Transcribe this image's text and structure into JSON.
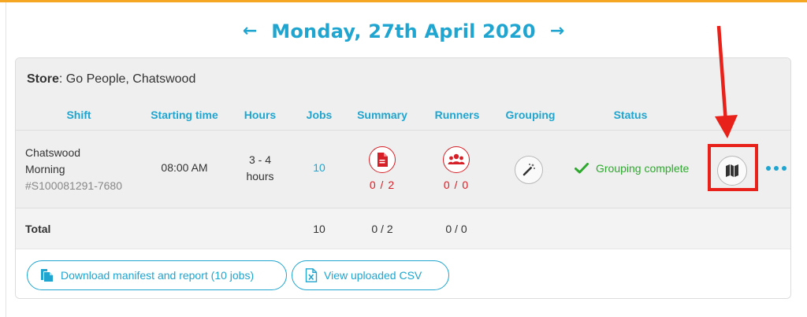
{
  "header": {
    "prev_arrow": "←",
    "next_arrow": "→",
    "date": "Monday, 27th April 2020"
  },
  "store": {
    "label": "Store",
    "value": ": Go People, Chatswood"
  },
  "table": {
    "columns": [
      "Shift",
      "Starting time",
      "Hours",
      "Jobs",
      "Summary",
      "Runners",
      "Grouping",
      "Status"
    ],
    "row": {
      "shift_line1": "Chatswood",
      "shift_line2": "Morning",
      "shift_code": "#S100081291-7680",
      "starting_time": "08:00 AM",
      "hours_line1": "3 - 4",
      "hours_line2": "hours",
      "jobs": "10",
      "summary": "0 / 2",
      "runners": "0 / 0",
      "status": "Grouping complete"
    },
    "total": {
      "label": "Total",
      "jobs": "10",
      "summary": "0 / 2",
      "runners": "0 / 0"
    }
  },
  "actions": {
    "download": "Download manifest and report (10 jobs)",
    "view_csv": "View uploaded CSV"
  },
  "icons": {
    "summary": "document-icon",
    "runners": "group-icon",
    "grouping": "magic-wand-icon",
    "map": "map-icon",
    "more": "more-icon",
    "status": "checkmark-icon"
  },
  "colors": {
    "accent": "#1fa5cf",
    "danger": "#d61f26",
    "success": "#2ea82e",
    "annotation": "#e8221a",
    "top_rule": "#f5a623"
  }
}
